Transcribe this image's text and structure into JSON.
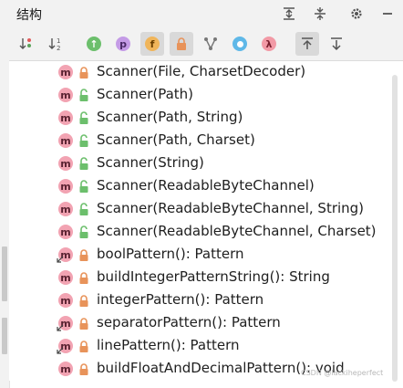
{
  "panel": {
    "title": "结构"
  },
  "titlebar_icons": [
    "expand-all-icon",
    "collapse-all-icon",
    "gear-icon",
    "minimize-icon"
  ],
  "toolbar": {
    "tools": [
      {
        "name": "sort-by-visibility",
        "active": false
      },
      {
        "name": "sort-alphabetically",
        "active": false
      },
      {
        "name": "show-inherited",
        "active": false
      },
      {
        "name": "show-properties",
        "glyph": "p",
        "active": false
      },
      {
        "name": "show-fields",
        "glyph": "f",
        "active": true
      },
      {
        "name": "show-non-public",
        "active": true
      },
      {
        "name": "show-anonymous",
        "active": false
      },
      {
        "name": "show-lambdas-circle",
        "active": false
      },
      {
        "name": "show-lambdas",
        "glyph": "λ",
        "active": false
      },
      {
        "name": "autoscroll-to-source",
        "active": true
      },
      {
        "name": "autoscroll-from-source",
        "active": false
      }
    ]
  },
  "members": [
    {
      "label": "Scanner(File, CharsetDecoder)",
      "lock": "private",
      "override": false
    },
    {
      "label": "Scanner(Path)",
      "lock": "public",
      "override": false
    },
    {
      "label": "Scanner(Path, String)",
      "lock": "public",
      "override": false
    },
    {
      "label": "Scanner(Path, Charset)",
      "lock": "public",
      "override": false
    },
    {
      "label": "Scanner(String)",
      "lock": "public",
      "override": false
    },
    {
      "label": "Scanner(ReadableByteChannel)",
      "lock": "public",
      "override": false
    },
    {
      "label": "Scanner(ReadableByteChannel, String)",
      "lock": "public",
      "override": false
    },
    {
      "label": "Scanner(ReadableByteChannel, Charset)",
      "lock": "public",
      "override": false
    },
    {
      "label": "boolPattern(): Pattern",
      "lock": "private",
      "override": true
    },
    {
      "label": "buildIntegerPatternString(): String",
      "lock": "private",
      "override": false
    },
    {
      "label": "integerPattern(): Pattern",
      "lock": "private",
      "override": false
    },
    {
      "label": "separatorPattern(): Pattern",
      "lock": "private",
      "override": true
    },
    {
      "label": "linePattern(): Pattern",
      "lock": "private",
      "override": true
    },
    {
      "label": "buildFloatAndDecimalPattern(): void",
      "lock": "private",
      "override": false
    }
  ],
  "member_icon_glyph": "m",
  "colors": {
    "method": "#f2a3b2",
    "private_lock": "#e8935a",
    "public_lock": "#6cbf6c",
    "accent": "#3574f0"
  },
  "watermark": "CSDN @lackiheperfect"
}
